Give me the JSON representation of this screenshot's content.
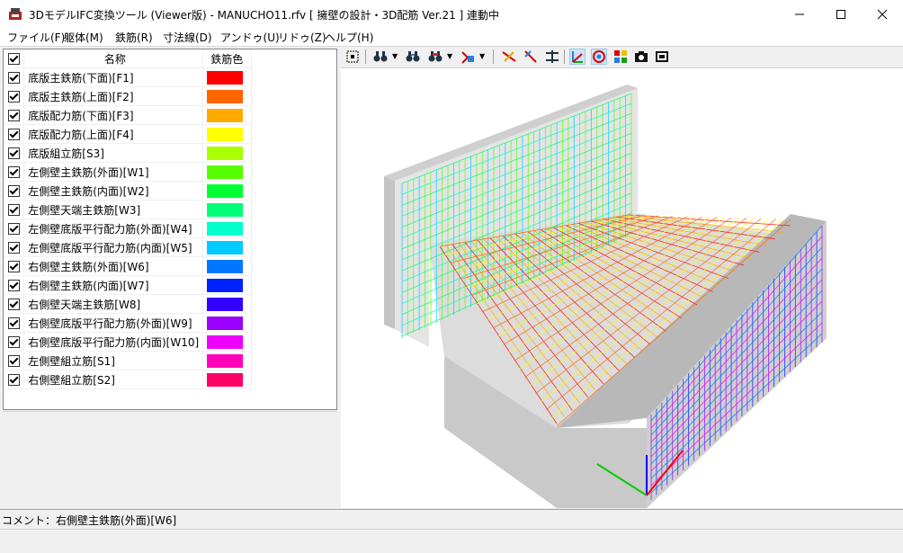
{
  "window": {
    "title": "3DモデルIFC変換ツール (Viewer版) - MANUCHO11.rfv [ 擁壁の設計・3D配筋 Ver.21 ] 連動中",
    "controls": [
      "—",
      "☐",
      "✕"
    ]
  },
  "menu": [
    {
      "label": "ファイル(F)"
    },
    {
      "label": "躯体(M)"
    },
    {
      "label": "鉄筋(R)"
    },
    {
      "label": "寸法線(D)"
    },
    {
      "label": "アンドゥ(U)"
    },
    {
      "label": "リドゥ(Z)"
    },
    {
      "label": "ヘルプ(H)"
    }
  ],
  "layer_table": {
    "header": {
      "name": "名称",
      "color": "鉄筋色"
    },
    "rows": [
      {
        "name": "底版主鉄筋(下面)[F1]",
        "color": "#ff0000",
        "checked": true
      },
      {
        "name": "底版主鉄筋(上面)[F2]",
        "color": "#ff6600",
        "checked": true
      },
      {
        "name": "底版配力筋(下面)[F3]",
        "color": "#ffaa00",
        "checked": true
      },
      {
        "name": "底版配力筋(上面)[F4]",
        "color": "#ffff00",
        "checked": true
      },
      {
        "name": "底版組立筋[S3]",
        "color": "#aaff00",
        "checked": true
      },
      {
        "name": "左側壁主鉄筋(外面)[W1]",
        "color": "#55ff00",
        "checked": true
      },
      {
        "name": "左側壁主鉄筋(内面)[W2]",
        "color": "#00ff33",
        "checked": true
      },
      {
        "name": "左側壁天端主鉄筋[W3]",
        "color": "#00ff77",
        "checked": true
      },
      {
        "name": "左側壁底版平行配力筋(外面)[W4]",
        "color": "#00ffcc",
        "checked": true
      },
      {
        "name": "左側壁底版平行配力筋(内面)[W5]",
        "color": "#00ccff",
        "checked": true
      },
      {
        "name": "右側壁主鉄筋(外面)[W6]",
        "color": "#0077ff",
        "checked": true
      },
      {
        "name": "右側壁主鉄筋(内面)[W7]",
        "color": "#0022ff",
        "checked": true
      },
      {
        "name": "右側壁天端主鉄筋[W8]",
        "color": "#3300ff",
        "checked": true
      },
      {
        "name": "右側壁底版平行配力筋(外面)[W9]",
        "color": "#9900ff",
        "checked": true
      },
      {
        "name": "右側壁底版平行配力筋(内面)[W10]",
        "color": "#ee00ff",
        "checked": true
      },
      {
        "name": "左側壁組立筋[S1]",
        "color": "#ff00bb",
        "checked": true
      },
      {
        "name": "右側壁組立筋[S2]",
        "color": "#ff0066",
        "checked": true
      }
    ]
  },
  "toolbar": {
    "icons": [
      "fit-view-icon",
      "binoculars-icon",
      "zoom-in-icon",
      "zoom-out-icon",
      "view-preset-icon",
      "rebar-select-icon",
      "rebar-transform-icon",
      "align-icon",
      "axis-toggle-icon",
      "render-mode-icon",
      "color-palette-icon",
      "camera-icon",
      "capture-icon"
    ]
  },
  "comment": {
    "label": "コメント：",
    "text": "右側壁主鉄筋(外面)[W6]"
  },
  "colors": {
    "concrete": "#d8d8d8",
    "panel_border": "#828790",
    "active_tool": "#cce4f7"
  }
}
